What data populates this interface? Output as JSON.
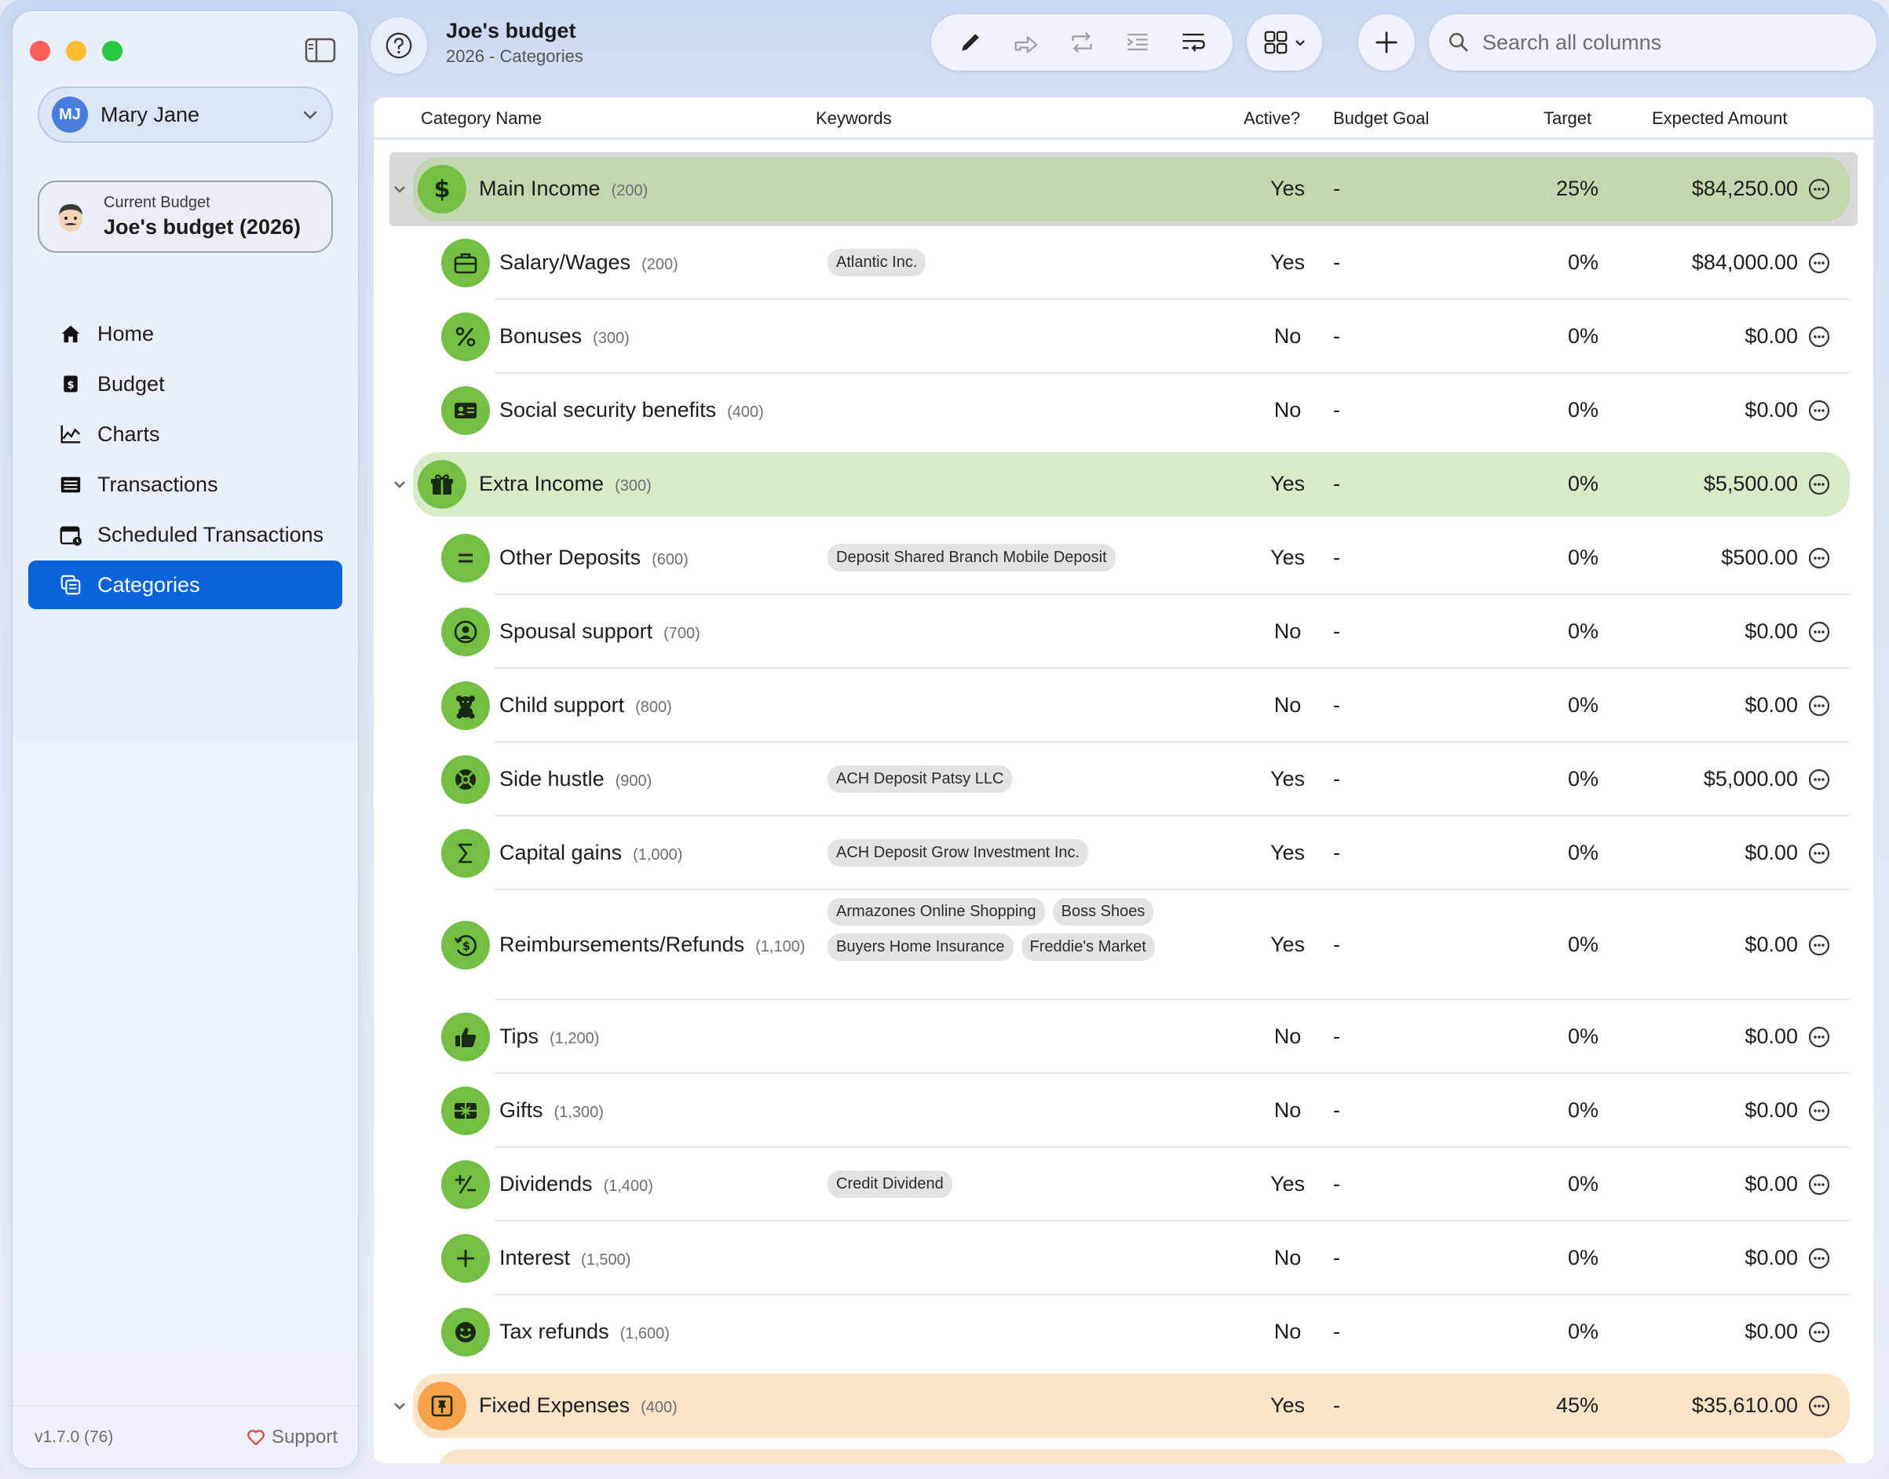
{
  "sidebar": {
    "user": {
      "initials": "MJ",
      "name": "Mary Jane"
    },
    "budget_caption": "Current Budget",
    "budget_name": "Joe's budget (2026)",
    "nav": [
      {
        "label": "Home",
        "icon": "house-icon"
      },
      {
        "label": "Budget",
        "icon": "dollar-doc-icon"
      },
      {
        "label": "Charts",
        "icon": "line-chart-icon"
      },
      {
        "label": "Transactions",
        "icon": "list-icon"
      },
      {
        "label": "Scheduled Transactions",
        "icon": "calendar-icon"
      },
      {
        "label": "Categories",
        "icon": "categories-icon",
        "active": true
      }
    ],
    "version": "v1.7.0 (76)",
    "support_label": "Support"
  },
  "header": {
    "title": "Joe's budget",
    "subtitle": "2026 - Categories",
    "search_placeholder": "Search all columns"
  },
  "table": {
    "columns": [
      "Category Name",
      "Keywords",
      "Active?",
      "Budget Goal",
      "Target",
      "Expected Amount"
    ],
    "rows": [
      {
        "kind": "group",
        "name": "Main Income",
        "count": "(200)",
        "active": "Yes",
        "goal": "-",
        "target": "25%",
        "amount": "$84,250.00",
        "icon": "dollar-icon",
        "keywords": []
      },
      {
        "kind": "item",
        "name": "Salary/Wages",
        "count": "(200)",
        "active": "Yes",
        "goal": "-",
        "target": "0%",
        "amount": "$84,000.00",
        "icon": "briefcase-icon",
        "keywords": [
          "Atlantic Inc."
        ]
      },
      {
        "kind": "item",
        "name": "Bonuses",
        "count": "(300)",
        "active": "No",
        "goal": "-",
        "target": "0%",
        "amount": "$0.00",
        "icon": "percent-icon",
        "keywords": []
      },
      {
        "kind": "item",
        "name": "Social security benefits",
        "count": "(400)",
        "active": "No",
        "goal": "-",
        "target": "0%",
        "amount": "$0.00",
        "icon": "id-card-icon",
        "keywords": []
      },
      {
        "kind": "group",
        "name": "Extra Income",
        "count": "(300)",
        "active": "Yes",
        "goal": "-",
        "target": "0%",
        "amount": "$5,500.00",
        "icon": "gift-icon",
        "keywords": []
      },
      {
        "kind": "item",
        "name": "Other Deposits",
        "count": "(600)",
        "active": "Yes",
        "goal": "-",
        "target": "0%",
        "amount": "$500.00",
        "icon": "equals-icon",
        "keywords": [
          "Deposit Shared Branch Mobile Deposit"
        ]
      },
      {
        "kind": "item",
        "name": "Spousal support",
        "count": "(700)",
        "active": "No",
        "goal": "-",
        "target": "0%",
        "amount": "$0.00",
        "icon": "person-circle-icon",
        "keywords": []
      },
      {
        "kind": "item",
        "name": "Child support",
        "count": "(800)",
        "active": "No",
        "goal": "-",
        "target": "0%",
        "amount": "$0.00",
        "icon": "teddy-bear-icon",
        "keywords": []
      },
      {
        "kind": "item",
        "name": "Side hustle",
        "count": "(900)",
        "active": "Yes",
        "goal": "-",
        "target": "0%",
        "amount": "$5,000.00",
        "icon": "lifebuoy-icon",
        "keywords": [
          "ACH Deposit Patsy LLC"
        ]
      },
      {
        "kind": "item",
        "name": "Capital gains",
        "count": "(1,000)",
        "active": "Yes",
        "goal": "-",
        "target": "0%",
        "amount": "$0.00",
        "icon": "sigma-icon",
        "keywords": [
          "ACH Deposit Grow Investment Inc."
        ]
      },
      {
        "kind": "item",
        "name": "Reimbursements/Refunds",
        "count": "(1,100)",
        "active": "Yes",
        "goal": "-",
        "target": "0%",
        "amount": "$0.00",
        "icon": "refund-icon",
        "keywords": [
          "Armazones Online Shopping",
          "Boss Shoes",
          "Buyers Home Insurance",
          "Freddie's Market"
        ]
      },
      {
        "kind": "item",
        "name": "Tips",
        "count": "(1,200)",
        "active": "No",
        "goal": "-",
        "target": "0%",
        "amount": "$0.00",
        "icon": "thumbs-up-icon",
        "keywords": []
      },
      {
        "kind": "item",
        "name": "Gifts",
        "count": "(1,300)",
        "active": "No",
        "goal": "-",
        "target": "0%",
        "amount": "$0.00",
        "icon": "gift-card-icon",
        "keywords": []
      },
      {
        "kind": "item",
        "name": "Dividends",
        "count": "(1,400)",
        "active": "Yes",
        "goal": "-",
        "target": "0%",
        "amount": "$0.00",
        "icon": "plus-minus-icon",
        "keywords": [
          "Credit Dividend"
        ]
      },
      {
        "kind": "item",
        "name": "Interest",
        "count": "(1,500)",
        "active": "No",
        "goal": "-",
        "target": "0%",
        "amount": "$0.00",
        "icon": "plus-icon",
        "keywords": []
      },
      {
        "kind": "item",
        "name": "Tax refunds",
        "count": "(1,600)",
        "active": "No",
        "goal": "-",
        "target": "0%",
        "amount": "$0.00",
        "icon": "smiley-icon",
        "keywords": []
      },
      {
        "kind": "group",
        "name": "Fixed Expenses",
        "count": "(400)",
        "active": "Yes",
        "goal": "-",
        "target": "45%",
        "amount": "$35,610.00",
        "icon": "pin-icon",
        "keywords": []
      }
    ]
  },
  "colors": {
    "accent": "#0a63d9",
    "income_group": "#c3d6ad",
    "extra_group": "#d9eac9",
    "expense_group": "#fde4c8",
    "income_icon": "#72bf44",
    "expense_icon": "#f6a24b"
  }
}
